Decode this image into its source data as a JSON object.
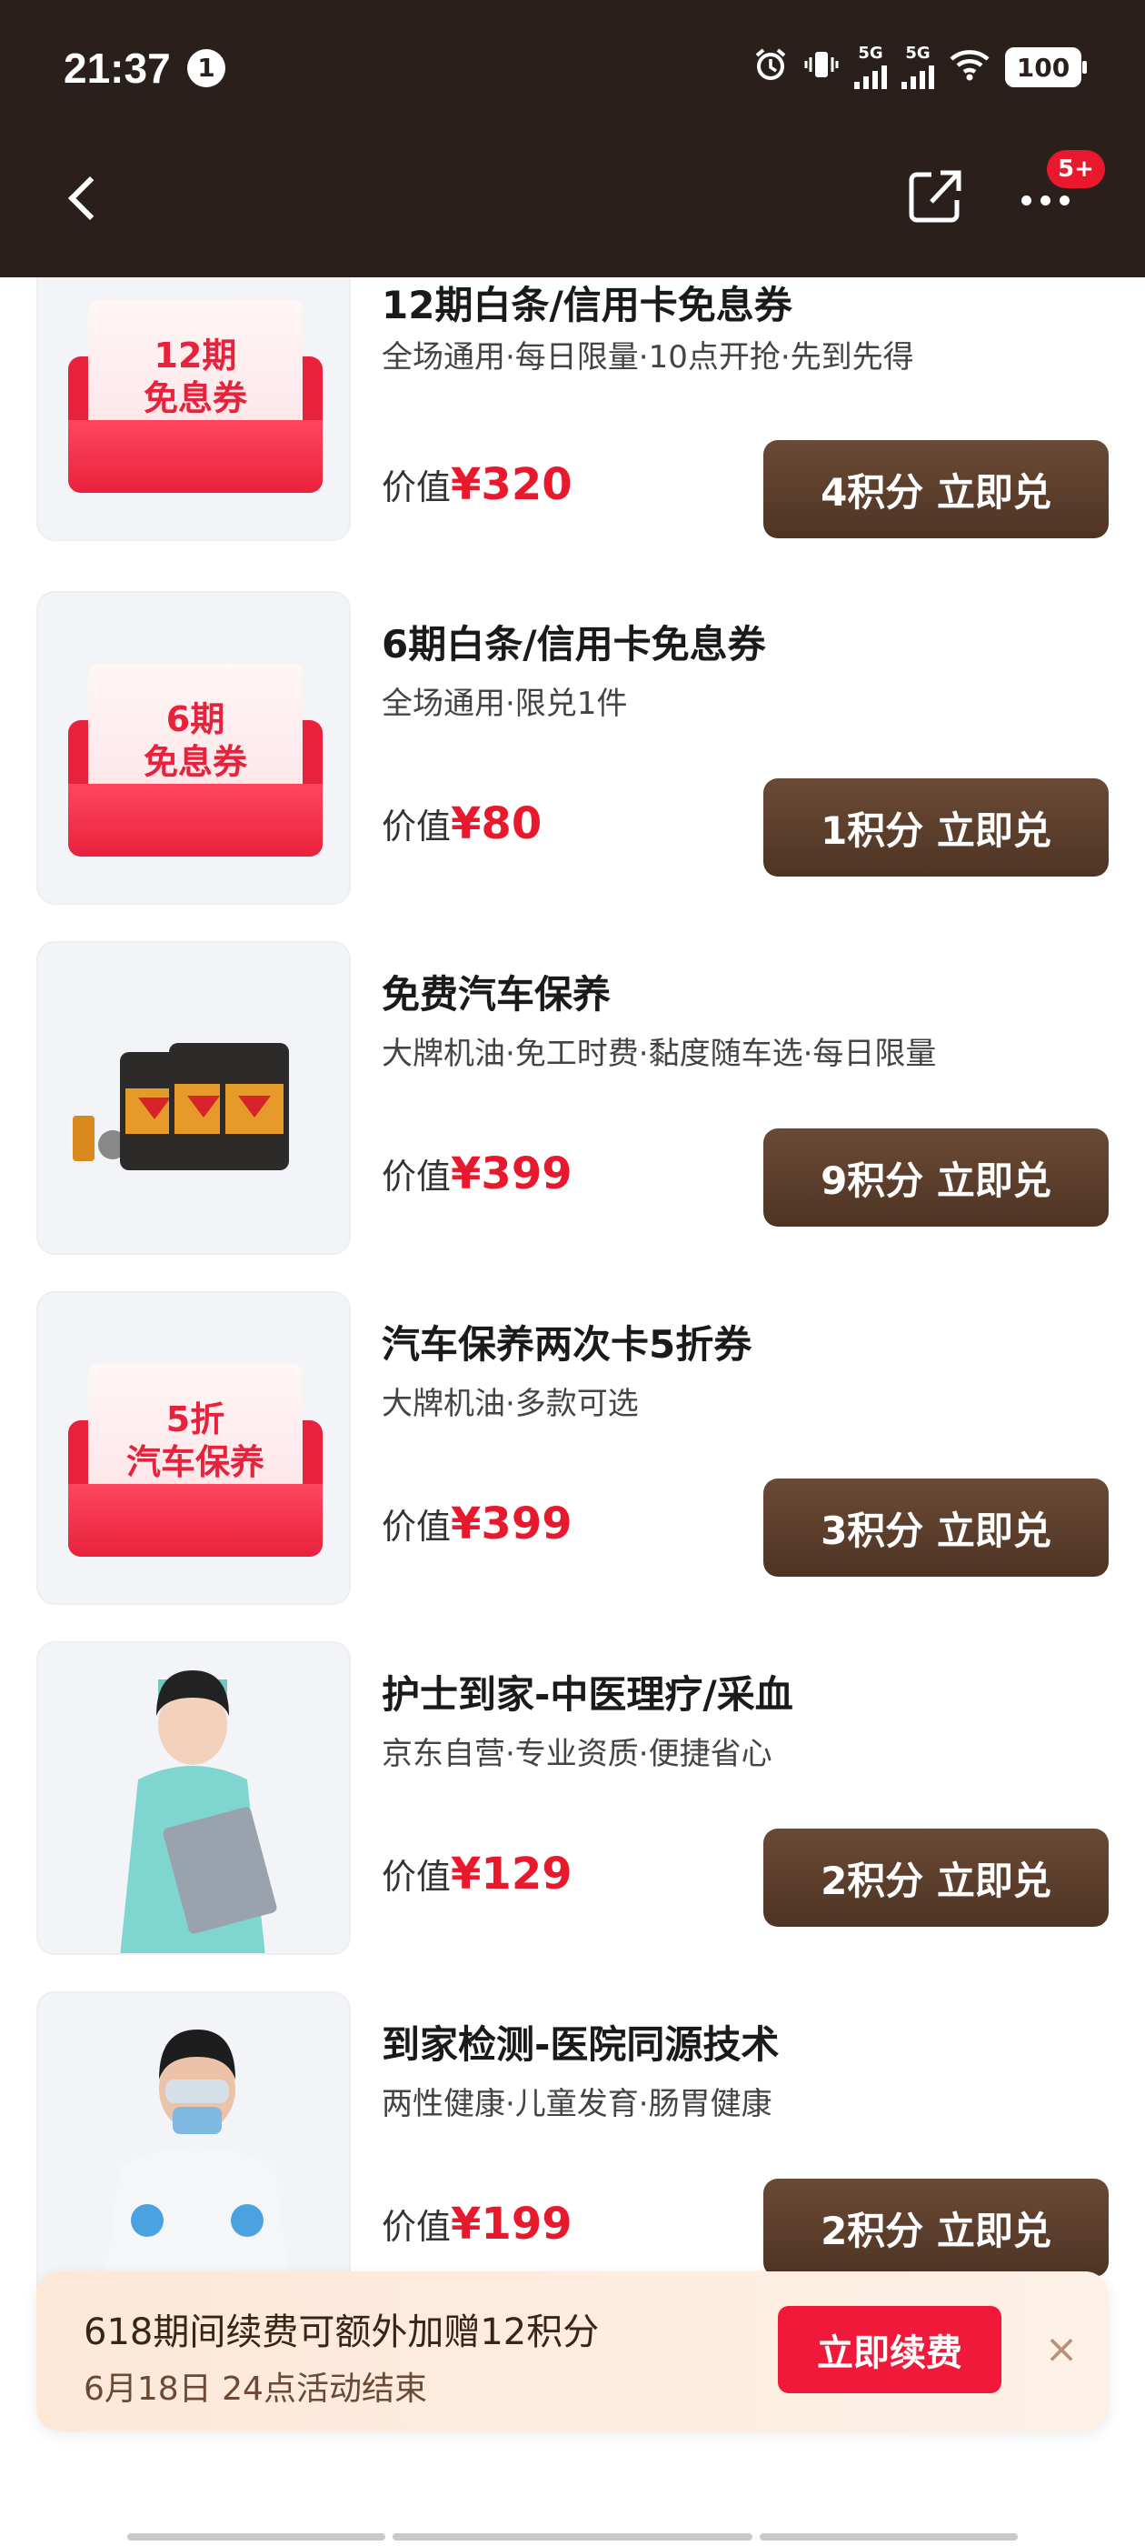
{
  "status_bar": {
    "time": "21:37",
    "notification_count": "1",
    "sim1": "5G",
    "sim2": "5G",
    "battery": "100"
  },
  "nav": {
    "more_badge": "5+"
  },
  "items": [
    {
      "title": "12期白条/信用卡免息券",
      "desc": "全场通用·每日限量·10点开抢·先到先得",
      "price_label": "价值",
      "price": "¥320",
      "button": "4积分 立即兑",
      "art_line1": "12期",
      "art_line2": "免息券"
    },
    {
      "title": "6期白条/信用卡免息券",
      "desc": "全场通用·限兑1件",
      "price_label": "价值",
      "price": "¥80",
      "button": "1积分 立即兑",
      "art_line1": "6期",
      "art_line2": "免息券"
    },
    {
      "title": "免费汽车保养",
      "desc": "大牌机油·免工时费·黏度随车选·每日限量",
      "price_label": "价值",
      "price": "¥399",
      "button": "9积分 立即兑"
    },
    {
      "title": "汽车保养两次卡5折券",
      "desc": "大牌机油·多款可选",
      "price_label": "价值",
      "price": "¥399",
      "button": "3积分 立即兑",
      "art_line1": "5折",
      "art_line2": "汽车保养"
    },
    {
      "title": "护士到家-中医理疗/采血",
      "desc": "京东自营·专业资质·便捷省心",
      "price_label": "价值",
      "price": "¥129",
      "button": "2积分 立即兑"
    },
    {
      "title": "到家检测-医院同源技术",
      "desc": "两性健康·儿童发育·肠胃健康",
      "price_label": "价值",
      "price": "¥199",
      "button": "2积分 立即兑"
    }
  ],
  "banner": {
    "line1": "618期间续费可额外加赠12积分",
    "line2": "6月18日 24点活动结束",
    "button": "立即续费",
    "close": "×"
  },
  "colors": {
    "header": "#2b1f1c",
    "price_red": "#e8192c",
    "button_brown": "#5a3c2a",
    "renew_red": "#f0193a"
  }
}
